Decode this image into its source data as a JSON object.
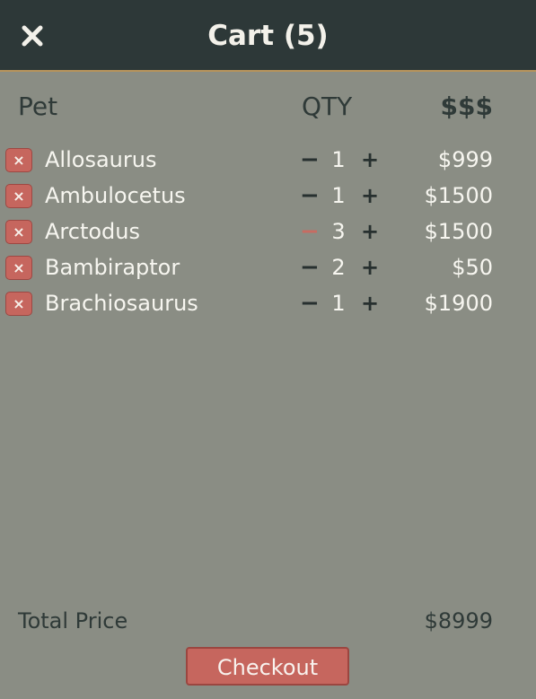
{
  "header": {
    "title": "Cart (5)",
    "close_icon": "close-icon"
  },
  "columns": {
    "pet": "Pet",
    "qty": "QTY",
    "price": "$$$"
  },
  "items": [
    {
      "name": "Allosaurus",
      "qty": "1",
      "price": "$999",
      "remove_icon": "×",
      "minus": "−",
      "plus": "+"
    },
    {
      "name": "Ambulocetus",
      "qty": "1",
      "price": "$1500",
      "remove_icon": "×",
      "minus": "−",
      "plus": "+"
    },
    {
      "name": "Arctodus",
      "qty": "3",
      "price": "$1500",
      "remove_icon": "×",
      "minus": "−",
      "plus": "+"
    },
    {
      "name": "Bambiraptor",
      "qty": "2",
      "price": "$50",
      "remove_icon": "×",
      "minus": "−",
      "plus": "+"
    },
    {
      "name": "Brachiosaurus",
      "qty": "1",
      "price": "$1900",
      "remove_icon": "×",
      "minus": "−",
      "plus": "+"
    }
  ],
  "total": {
    "label": "Total Price",
    "value": "$8999"
  },
  "checkout_label": "Checkout",
  "colors": {
    "header_bg": "#2d3838",
    "panel_bg": "#8a8d84",
    "accent_red": "#c6665e"
  }
}
